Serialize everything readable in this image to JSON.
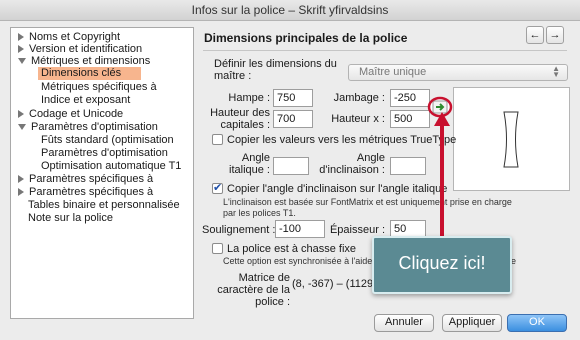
{
  "window": {
    "title": "Infos sur la police – Skrift yfirvaldsins"
  },
  "sidebar": {
    "items": [
      {
        "label": "Noms et Copyright",
        "arrow": "right"
      },
      {
        "label": "Version et identification",
        "arrow": "right"
      },
      {
        "label": "Métriques et dimensions",
        "arrow": "down"
      },
      {
        "label": "Dimensions clés",
        "selected": true
      },
      {
        "label": "Métriques spécifiques à"
      },
      {
        "label": "Indice et exposant"
      },
      {
        "label": "Codage et Unicode",
        "arrow": "right"
      },
      {
        "label": "Paramètres d'optimisation",
        "arrow": "down"
      },
      {
        "label": "Fûts standard (optimisation"
      },
      {
        "label": "Paramètres d'optimisation"
      },
      {
        "label": "Optimisation automatique T1"
      },
      {
        "label": "Paramètres spécifiques à",
        "arrow": "right"
      },
      {
        "label": "Paramètres spécifiques à",
        "arrow": "right"
      },
      {
        "label": "Tables binaire et personnalisée"
      },
      {
        "label": "Note sur la police"
      }
    ]
  },
  "panel": {
    "title": "Dimensions principales de la police",
    "nav_prev": "←",
    "nav_next": "→",
    "define_label": "Définir les dimensions du maître :",
    "master_select": "Maître unique",
    "hampe_label": "Hampe :",
    "hampe_value": "750",
    "jambage_label": "Jambage :",
    "jambage_value": "-250",
    "capheight_label": "Hauteur des capitales :",
    "capheight_value": "700",
    "xheight_label": "Hauteur x :",
    "xheight_value": "500",
    "copy_truetype_label": "Copier les valeurs vers les métriques TrueType",
    "angle_italic_label": "Angle italique :",
    "angle_italic_value": "",
    "angle_slant_label": "Angle d'inclinaison :",
    "angle_slant_value": "",
    "copy_angle_label": "Copier l'angle d'inclinaison sur l'angle italique",
    "copy_angle_checked": true,
    "copy_angle_note": "L'inclinaison est basée sur FontMatrix et est uniquement prise en charge par les polices T1.",
    "underline_label": "Soulignement :",
    "underline_value": "-100",
    "thickness_label": "Épaisseur :",
    "thickness_value": "50",
    "fixed_pitch_label": "La police est à chasse fixe",
    "fixed_pitch_note_start": "Cette option est synchronisée à l'aide d",
    "fixed_pitch_note_end": "e",
    "matrix_label": "Matrice de caractère de la police :",
    "matrix_value": "(8, -367) – (1129, 921)"
  },
  "tooltip": {
    "text": "Cliquez ici!"
  },
  "buttons": {
    "cancel": "Annuler",
    "apply": "Appliquer",
    "ok": "OK"
  },
  "colors": {
    "selection": "#f7b58e",
    "tooltip": "#5b8a93",
    "highlight_ring": "#c8102e",
    "ok": "#3b8fe0"
  }
}
